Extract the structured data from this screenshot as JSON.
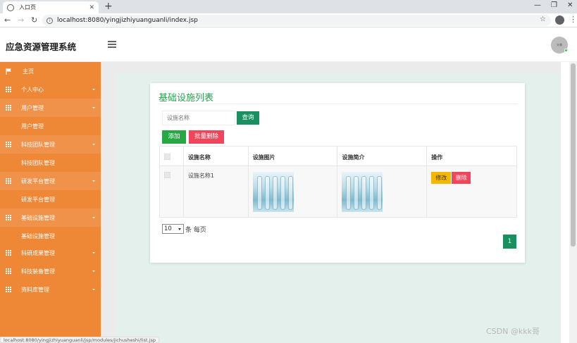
{
  "browser": {
    "tab_title": "入口页",
    "url": "localhost:8080/yingjizhiyuanguanli/index.jsp",
    "status_url": "localhost:8080/yingjizhiyuanguanli/jsp/modules/jichusheshi/list.jsp"
  },
  "header": {
    "brand": "应急资源管理系统",
    "avatar_text": "头像"
  },
  "sidebar": {
    "items": [
      {
        "label": "主页",
        "icon": "flag-icon",
        "caret": false,
        "open": false
      },
      {
        "label": "个人中心",
        "icon": "grid-icon",
        "caret": true,
        "open": false
      },
      {
        "label": "用户管理",
        "icon": "grid-icon",
        "caret": true,
        "open": true
      },
      {
        "label": "用户管理",
        "sub": true
      },
      {
        "label": "科技团队管理",
        "icon": "grid-icon",
        "caret": true,
        "open": true
      },
      {
        "label": "科技团队管理",
        "sub": true
      },
      {
        "label": "研发平台管理",
        "icon": "grid-icon",
        "caret": true,
        "open": true
      },
      {
        "label": "研发平台管理",
        "sub": true
      },
      {
        "label": "基础设施管理",
        "icon": "grid-icon",
        "caret": true,
        "open": true
      },
      {
        "label": "基础设施管理",
        "sub": true
      },
      {
        "label": "科研成果管理",
        "icon": "grid-icon",
        "caret": true,
        "open": false
      },
      {
        "label": "科技装备管理",
        "icon": "grid-icon",
        "caret": true,
        "open": false
      },
      {
        "label": "资料库管理",
        "icon": "grid-icon",
        "caret": true,
        "open": false
      }
    ]
  },
  "main": {
    "title": "基础设施列表",
    "search_placeholder": "设施名称",
    "search_label": "查询",
    "add_label": "添加",
    "bulk_delete_label": "批量删除",
    "table": {
      "columns": [
        "",
        "设施名称",
        "设施图片",
        "设施简介",
        "操作"
      ],
      "rows": [
        {
          "name": "设施名称1",
          "edit": "修改",
          "delete": "删除"
        }
      ]
    },
    "page_size": "10",
    "page_size_label": "条 每页",
    "current_page": "1"
  },
  "watermark": "CSDN @kkk哥"
}
